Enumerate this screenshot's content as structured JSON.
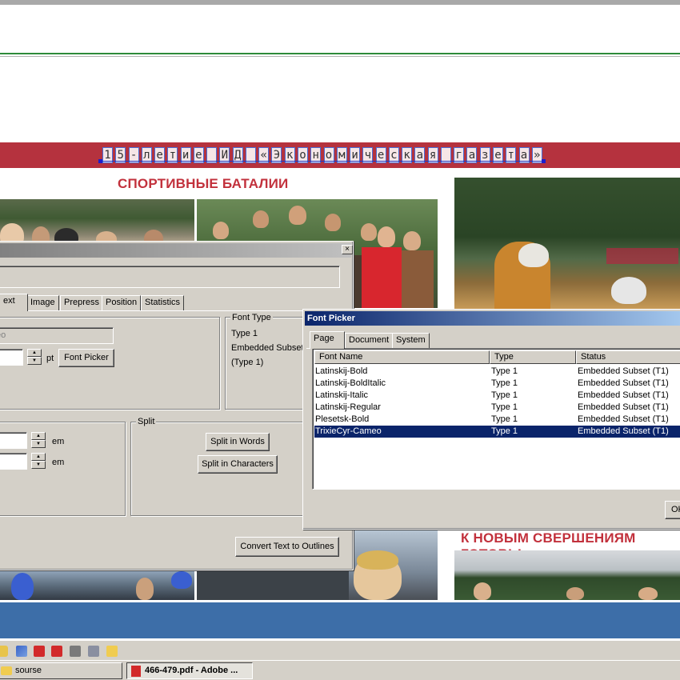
{
  "document": {
    "headline": "15-летие ИД «Экономическая газета»",
    "section_sports": "СПОРТИВНЫЕ БАТАЛИИ",
    "section_new": "К НОВЫМ СВЕРШЕНИЯМ ГОТОВЫ"
  },
  "text_panel": {
    "tabs": [
      "ext",
      "Image",
      "Prepress",
      "Position",
      "Statistics"
    ],
    "font_name_value": "eo",
    "font_size_value": "",
    "pt_label": "pt",
    "font_picker_button": "Font Picker",
    "font_type_group": "Font Type",
    "font_type_lines": [
      "Type 1",
      "Embedded Subset",
      "(Type 1)"
    ],
    "split_group": "Split",
    "em_label": "em",
    "split_words_button": "Split in Words",
    "split_chars_button": "Split in Characters",
    "convert_button": "Convert Text to Outlines",
    "close_glyph": "×"
  },
  "font_picker": {
    "title": "Font Picker",
    "tabs": [
      "Page",
      "Document",
      "System"
    ],
    "columns": [
      "Font Name",
      "Type",
      "Status"
    ],
    "rows": [
      {
        "name": "Latinskij-Bold",
        "type": "Type 1",
        "status": "Embedded Subset (T1)"
      },
      {
        "name": "Latinskij-BoldItalic",
        "type": "Type 1",
        "status": "Embedded Subset (T1)"
      },
      {
        "name": "Latinskij-Italic",
        "type": "Type 1",
        "status": "Embedded Subset (T1)"
      },
      {
        "name": "Latinskij-Regular",
        "type": "Type 1",
        "status": "Embedded Subset (T1)"
      },
      {
        "name": "Plesetsk-Bold",
        "type": "Type 1",
        "status": "Embedded Subset (T1)"
      },
      {
        "name": "TrixieCyr-Cameo",
        "type": "Type 1",
        "status": "Embedded Subset (T1)"
      }
    ],
    "selected_index": 5,
    "ok_button": "OK"
  },
  "taskbar": {
    "items": [
      {
        "label": "sourse"
      },
      {
        "label": "466-479.pdf - Adobe ..."
      }
    ]
  },
  "colors": {
    "accent_red": "#b5323e",
    "headline_red": "#c2313c",
    "selection_blue": "#0a246a",
    "band_blue": "#3d6ea8"
  }
}
